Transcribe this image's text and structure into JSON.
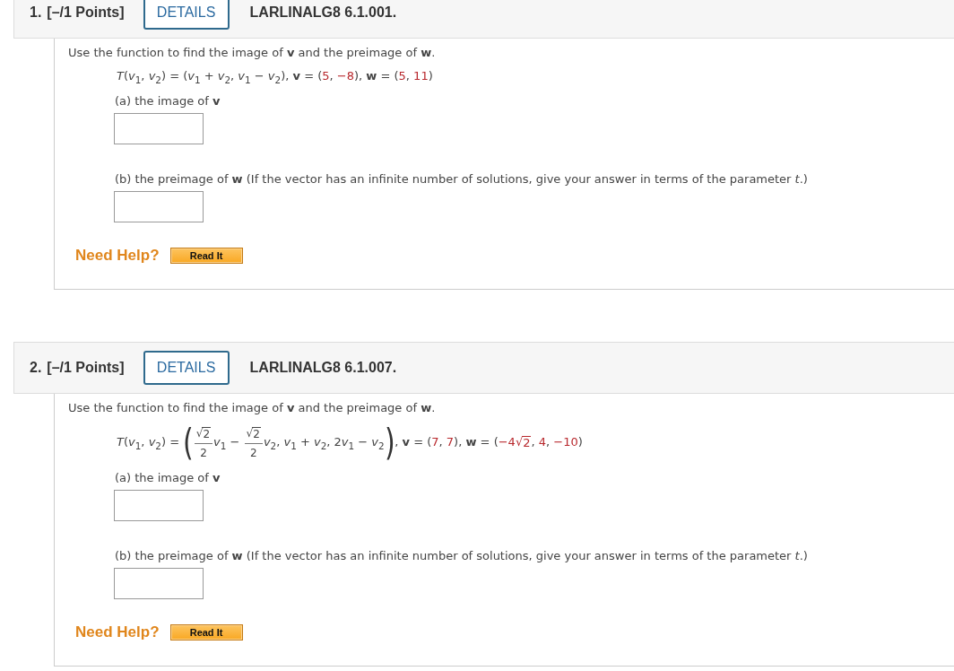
{
  "questions": [
    {
      "number": "1.",
      "points": "[–/1 Points]",
      "details_button": "DETAILS",
      "problem_id": "LARLINALG8 6.1.001.",
      "instruction": "Use the function to find the image of **v** and the preimage of **w**.",
      "formula": [
        {
          "kind": "text",
          "text": "*T*(*v*$_{1}$, *v*$_{2}$) = (*v*$_{1}$ + *v*$_{2}$, *v*$_{1}$ − *v*$_{2}$), **v** = ("
        },
        {
          "kind": "value",
          "text": "5"
        },
        {
          "kind": "text",
          "text": ", "
        },
        {
          "kind": "value",
          "text": "−8"
        },
        {
          "kind": "text",
          "text": "), **w** = ("
        },
        {
          "kind": "value",
          "text": "5"
        },
        {
          "kind": "text",
          "text": ", "
        },
        {
          "kind": "value",
          "text": "11"
        },
        {
          "kind": "text",
          "text": ")"
        }
      ],
      "parts": [
        {
          "label": "(a) the image of **v**"
        },
        {
          "label": "(b) the preimage of **w** (If the vector has an infinite number of solutions, give your answer in terms of the parameter *t*.)"
        }
      ],
      "help_label": "Need Help?",
      "help_button": "Read It"
    },
    {
      "number": "2.",
      "points": "[–/1 Points]",
      "details_button": "DETAILS",
      "problem_id": "LARLINALG8 6.1.007.",
      "instruction": "Use the function to find the image of **v** and the preimage of **w**.",
      "formula": [
        {
          "kind": "text",
          "text": "*T*(*v*$_{1}$, *v*$_{2}$) = "
        },
        {
          "kind": "paren",
          "text": "("
        },
        {
          "kind": "fraction",
          "numerator": [
            {
              "kind": "sqrt",
              "sign": "√",
              "radicand": "2",
              "highlighted": false
            }
          ],
          "denominator": [
            {
              "kind": "text",
              "text": "2"
            }
          ]
        },
        {
          "kind": "text",
          "text": "*v*$_{1}$ − "
        },
        {
          "kind": "fraction",
          "numerator": [
            {
              "kind": "sqrt",
              "sign": "√",
              "radicand": "2",
              "highlighted": false
            }
          ],
          "denominator": [
            {
              "kind": "text",
              "text": "2"
            }
          ]
        },
        {
          "kind": "text",
          "text": "*v*$_{2}$, *v*$_{1}$ + *v*$_{2}$, 2"
        },
        {
          "kind": "text",
          "text": "*v*$_{1}$ − *v*$_{2}$"
        },
        {
          "kind": "paren",
          "text": ")"
        },
        {
          "kind": "text",
          "text": ", **v** = ("
        },
        {
          "kind": "value",
          "text": "7"
        },
        {
          "kind": "text",
          "text": ", "
        },
        {
          "kind": "value",
          "text": "7"
        },
        {
          "kind": "text",
          "text": "), **w** = ("
        },
        {
          "kind": "value",
          "text": "−4"
        },
        {
          "kind": "sqrt",
          "sign": "√",
          "radicand": "2",
          "highlighted": true
        },
        {
          "kind": "text",
          "text": ", "
        },
        {
          "kind": "value",
          "text": "4"
        },
        {
          "kind": "text",
          "text": ", "
        },
        {
          "kind": "value",
          "text": "−10"
        },
        {
          "kind": "text",
          "text": ")"
        }
      ],
      "parts": [
        {
          "label": "(a) the image of **v**"
        },
        {
          "label": "(b) the preimage of **w** (If the vector has an infinite number of solutions, give your answer in terms of the parameter *t*.)"
        }
      ],
      "help_label": "Need Help?",
      "help_button": "Read It"
    }
  ]
}
